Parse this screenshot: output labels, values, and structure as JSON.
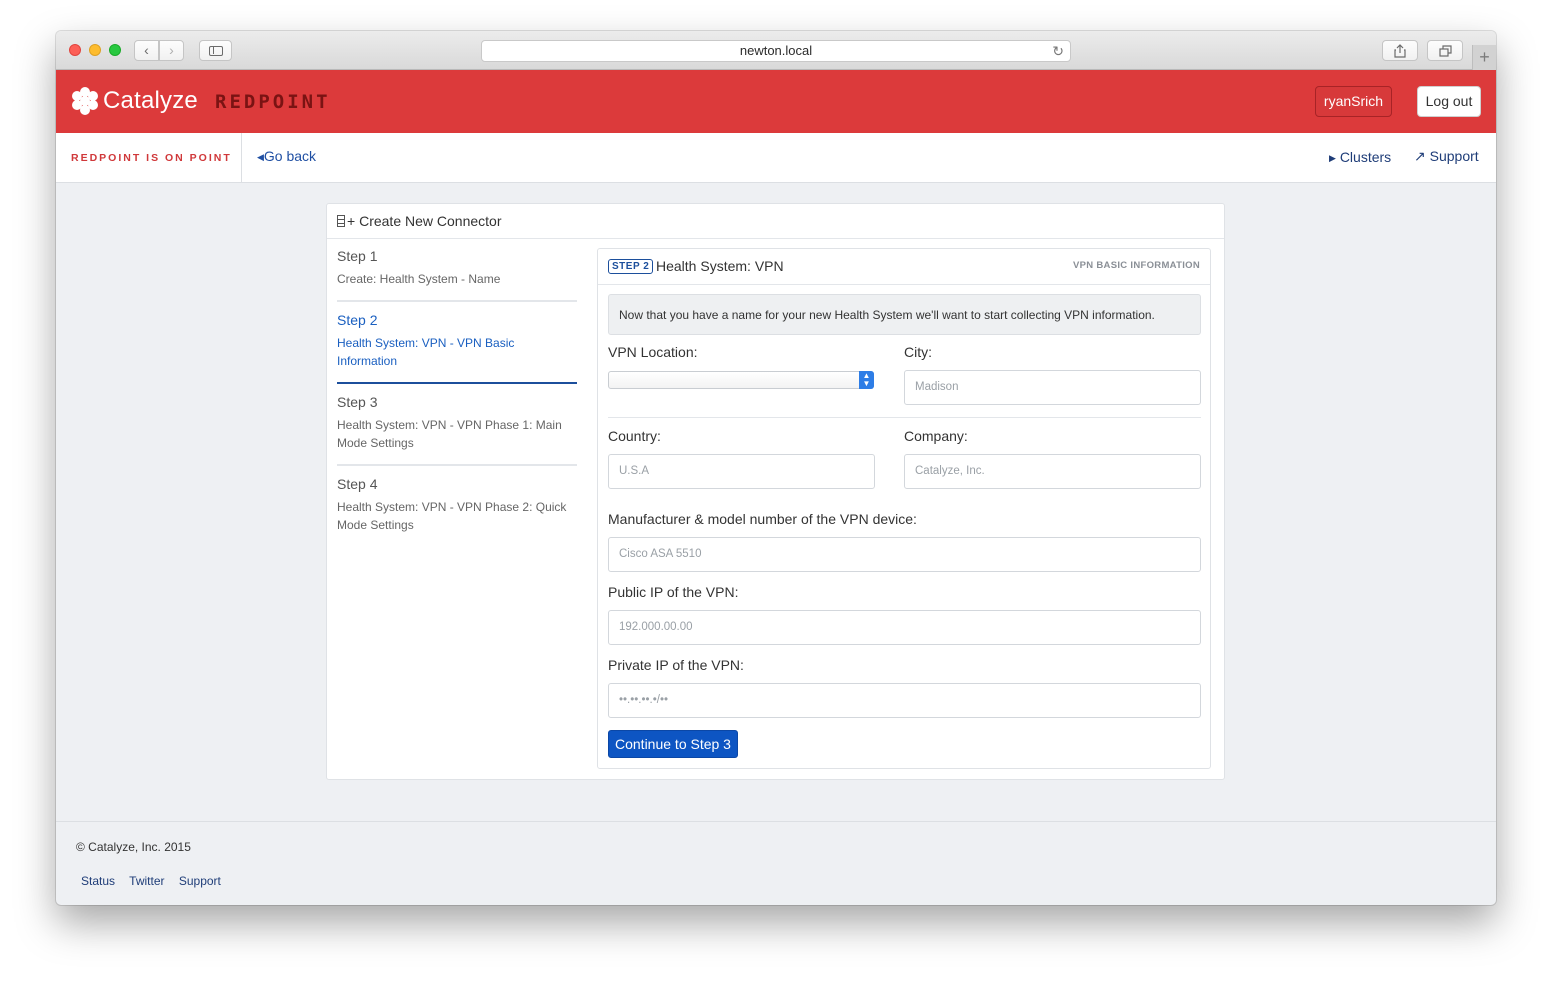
{
  "browser": {
    "url": "newton.local",
    "new_tab_glyph": "+"
  },
  "header": {
    "brand": "Catalyze",
    "product": "REDPOINT",
    "user_label": "ryanSrich",
    "logout_label": "Log out",
    "accent": "#dc3a3b"
  },
  "subnav": {
    "tagline": "REDPOINT IS ON POINT",
    "go_back": "Go back",
    "clusters": "Clusters",
    "support": "Support"
  },
  "card": {
    "title": "Create New Connector",
    "icon": "add-grid-icon"
  },
  "steps": [
    {
      "title": "Step 1",
      "desc": "Create: Health System - Name"
    },
    {
      "title": "Step 2",
      "desc": "Health System: VPN - VPN Basic Information"
    },
    {
      "title": "Step 3",
      "desc": "Health System: VPN - VPN Phase 1: Main Mode Settings"
    },
    {
      "title": "Step 4",
      "desc": "Health System: VPN - VPN Phase 2: Quick Mode Settings"
    }
  ],
  "panel": {
    "badge": "STEP 2",
    "title": "Health System: VPN",
    "tag": "VPN BASIC INFORMATION",
    "info": "Now that you have a name for your new Health System we'll want to start collecting VPN information.",
    "fields": {
      "vpn_location": {
        "label": "VPN Location:",
        "value": ""
      },
      "city": {
        "label": "City:",
        "placeholder": "Madison"
      },
      "country": {
        "label": "Country:",
        "placeholder": "U.S.A"
      },
      "company": {
        "label": "Company:",
        "placeholder": "Catalyze, Inc."
      },
      "manufacturer": {
        "label": "Manufacturer & model number of the VPN device:",
        "placeholder": "Cisco ASA 5510"
      },
      "public_ip": {
        "label": "Public IP of the VPN:",
        "placeholder": "192.000.00.00"
      },
      "private_ip": {
        "label": "Private IP of the VPN:",
        "placeholder": "••.••.••.•/••"
      }
    },
    "continue_label": "Continue to Step 3"
  },
  "footer": {
    "copyright": "© Catalyze, Inc. 2015",
    "links": [
      "Status",
      "Twitter",
      "Support"
    ]
  }
}
